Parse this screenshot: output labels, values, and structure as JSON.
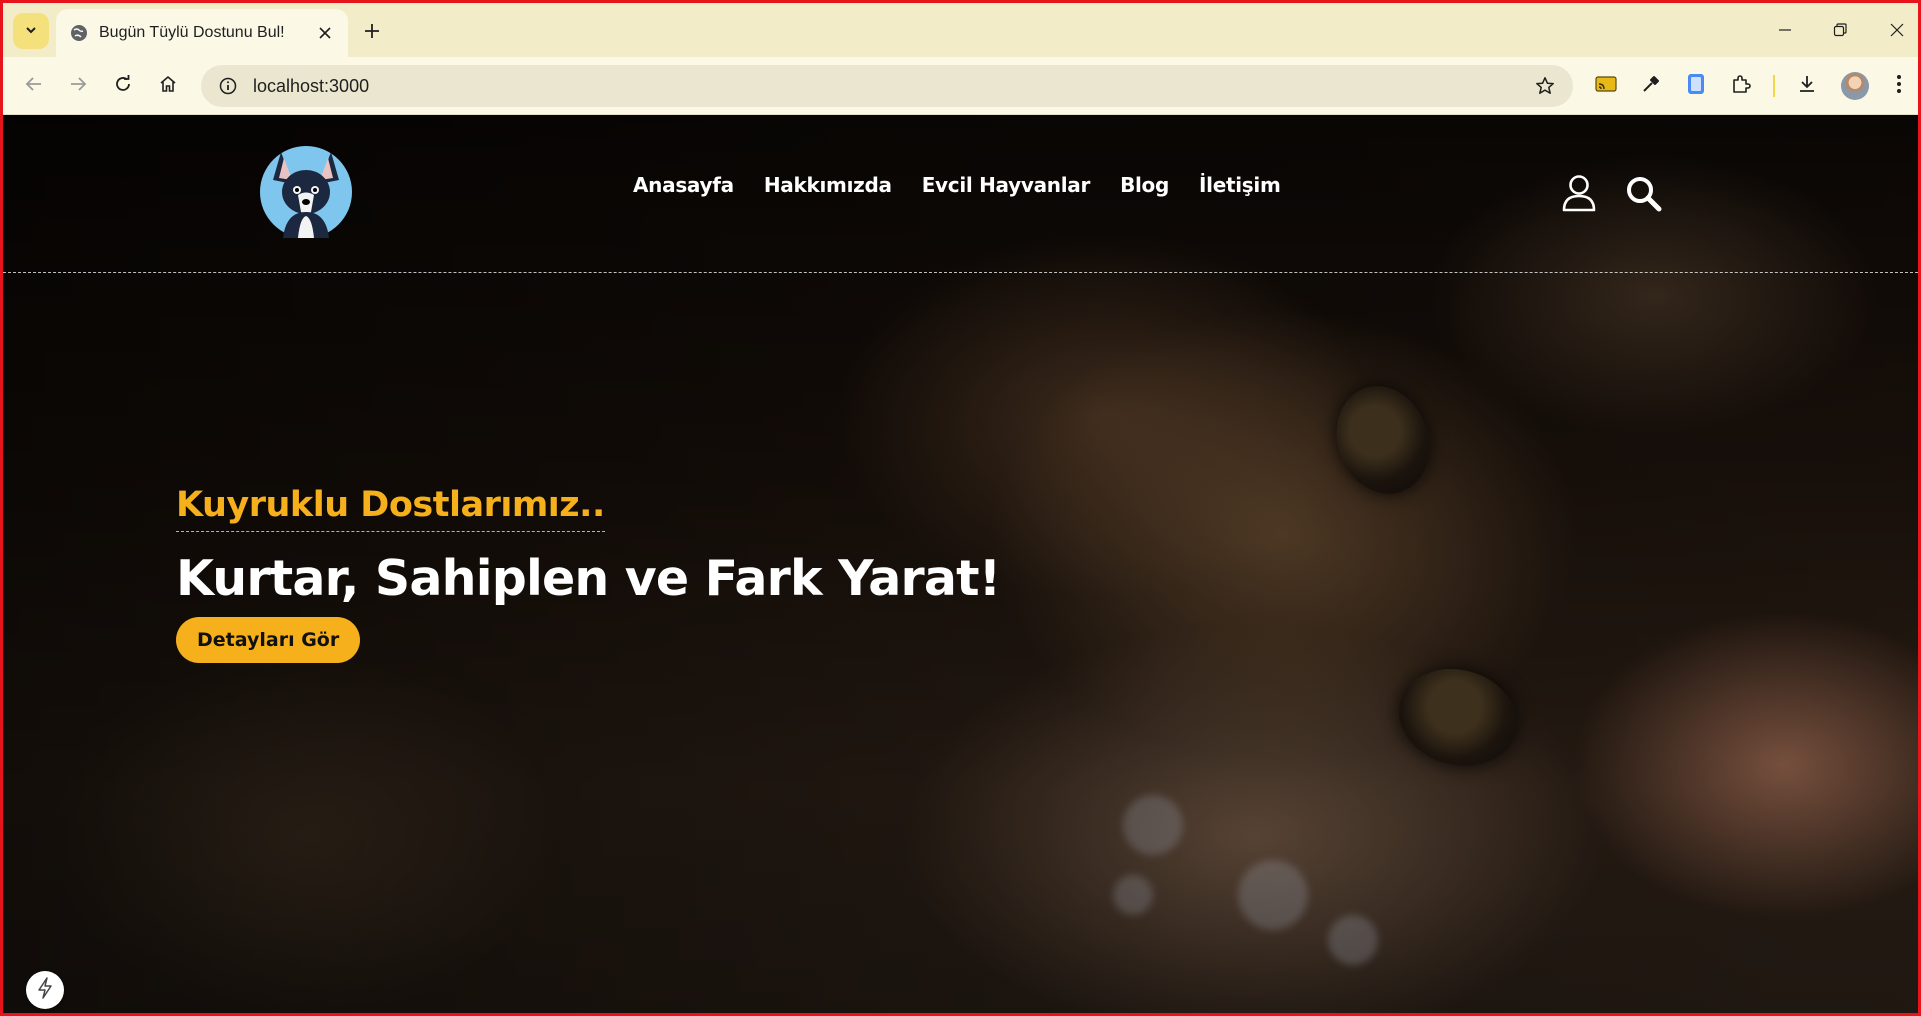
{
  "browser": {
    "tab": {
      "title": "Bugün Tüylü Dostunu Bul!"
    },
    "omnibox": {
      "url": "localhost:3000"
    },
    "icons": [
      "tab-search-icon",
      "globe-icon",
      "close-icon",
      "plus-icon",
      "minimize-icon",
      "restore-icon",
      "window-close-icon",
      "back-arrow-icon",
      "forward-arrow-icon",
      "reload-icon",
      "home-icon",
      "info-icon",
      "star-icon",
      "cast-icon",
      "eyedropper-icon",
      "tablet-icon",
      "puzzle-icon",
      "download-icon",
      "kebab-menu-icon"
    ],
    "colors": {
      "frame": "#e8141c",
      "tabstrip": "#f2edc8",
      "toolbar": "#fbf8e6"
    }
  },
  "site": {
    "nav": {
      "home": "Anasayfa",
      "about": "Hakkımızda",
      "pets": "Evcil Hayvanlar",
      "blog": "Blog",
      "contact": "İletişim"
    },
    "hero": {
      "kicker": "Kuyruklu Dostlarımız..",
      "headline": "Kurtar, Sahiplen ve Fark Yarat!",
      "cta": "Detayları Gör"
    },
    "icons": [
      "dog-logo",
      "user-icon",
      "search-icon",
      "lightning-icon"
    ],
    "colors": {
      "accent": "#f6b01c",
      "text": "#ffffff"
    }
  }
}
